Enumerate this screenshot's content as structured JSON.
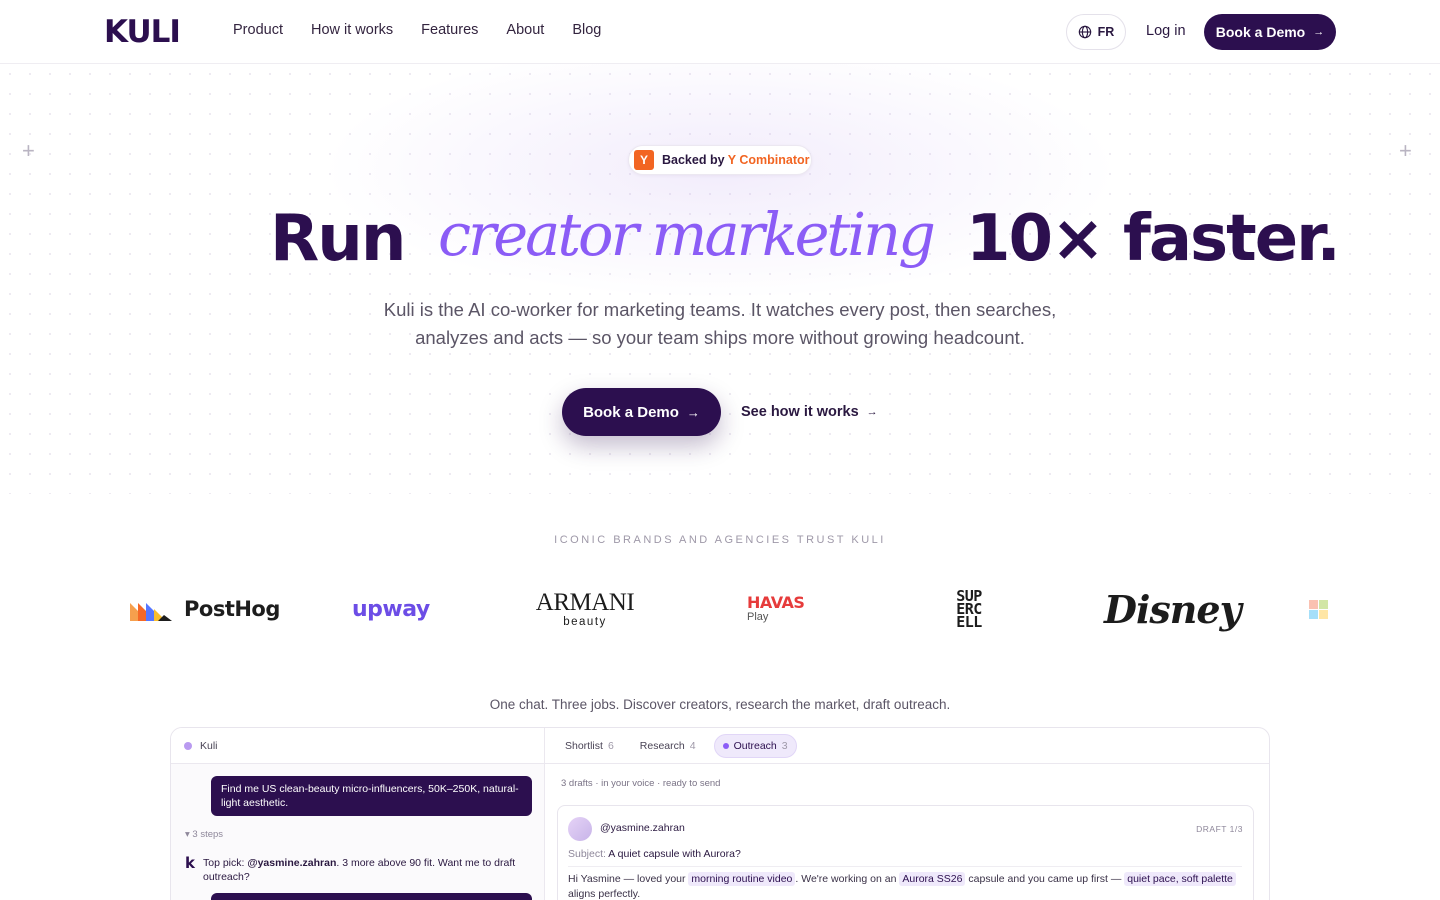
{
  "header": {
    "logo": "KULI",
    "nav": [
      "Product",
      "How it works",
      "Features",
      "About",
      "Blog"
    ],
    "lang": "FR",
    "login": "Log in",
    "book_demo": "Book a Demo",
    "arrow": "→"
  },
  "hero": {
    "badge_prefix": "Backed by",
    "badge_brand": "Y Combinator",
    "badge_icon": "Y",
    "headline_start": "Run",
    "headline_accent": "creator marketing",
    "headline_end": "10× faster.",
    "subtitle": "Kuli is the AI co-worker for marketing teams. It watches every post, then searches, analyzes and acts — so your team ships more without growing headcount.",
    "cta_primary": "Book a Demo",
    "cta_secondary": "See how it works"
  },
  "brands": {
    "heading": "ICONIC BRANDS AND AGENCIES TRUST KULI",
    "posthog": "PostHog",
    "upway": "upway",
    "armani_1": "ARMANI",
    "armani_2": "beauty",
    "havas_1": "HAVAS",
    "havas_2": "Play",
    "supercell": [
      "SUP",
      "ERC",
      "ELL"
    ],
    "disney": "Disney"
  },
  "preview": {
    "caption": "One chat. Three jobs. Discover creators, research the market, draft outreach.",
    "chat_title": "Kuli",
    "user_message": "Find me US clean-beauty micro-influencers, 50K–250K, natural-light aesthetic.",
    "steps": "▾ 3 steps",
    "reply_prefix": "Top pick: ",
    "reply_handle": "@yasmine.zahran",
    "reply_suffix": ". 3 more above 90 fit. Want me to draft outreach?",
    "tabs": [
      {
        "label": "Shortlist",
        "count": "6"
      },
      {
        "label": "Research",
        "count": "4"
      },
      {
        "label": "Outreach",
        "count": "3"
      }
    ],
    "drafts_note": "3 drafts · in your voice · ready to send",
    "draft": {
      "handle": "@yasmine.zahran",
      "number": "DRAFT 1/3",
      "subject_label": "Subject:",
      "subject": "A quiet capsule with Aurora?",
      "body_1": "Hi Yasmine — loved your ",
      "hl_1": "morning routine video",
      "body_2": ". We're working on an ",
      "hl_2": "Aurora SS26",
      "body_3": " capsule and you came up first — ",
      "hl_3": "quiet pace, soft palette",
      "body_4": " aligns perfectly."
    }
  }
}
